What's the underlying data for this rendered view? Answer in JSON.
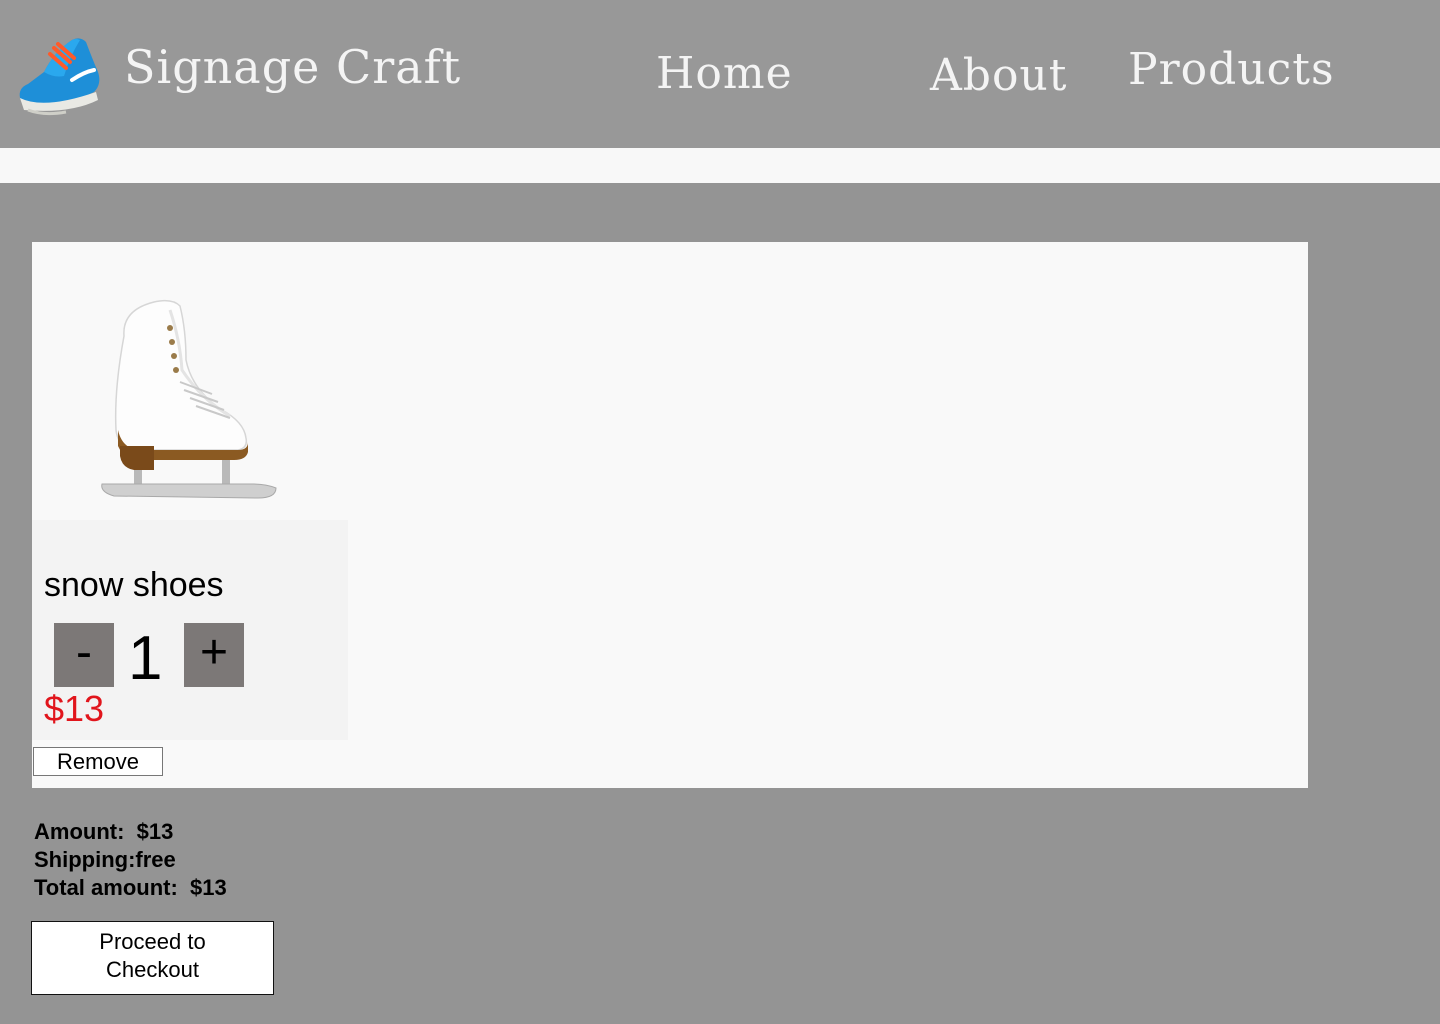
{
  "header": {
    "logo_icon": "sneaker-logo-icon",
    "brand": "Signage Craft",
    "nav": {
      "home": "Home",
      "about": "About",
      "products": "Products"
    }
  },
  "cart": {
    "item": {
      "image_icon": "ice-skate-image",
      "name": "snow shoes",
      "quantity": "1",
      "minus_label": "-",
      "plus_label": "+",
      "price": "$13",
      "remove_label": "Remove"
    }
  },
  "summary": {
    "amount_label": "Amount:",
    "amount_value": "$13",
    "shipping_label": "Shipping:",
    "shipping_value": "free",
    "total_label": "Total amount:",
    "total_value": "$13"
  },
  "checkout": {
    "line1": "Proceed to",
    "line2": "Checkout"
  },
  "colors": {
    "background": "#949494",
    "header": "#989898",
    "price": "#e1151c",
    "qty_button": "#7c7877"
  }
}
